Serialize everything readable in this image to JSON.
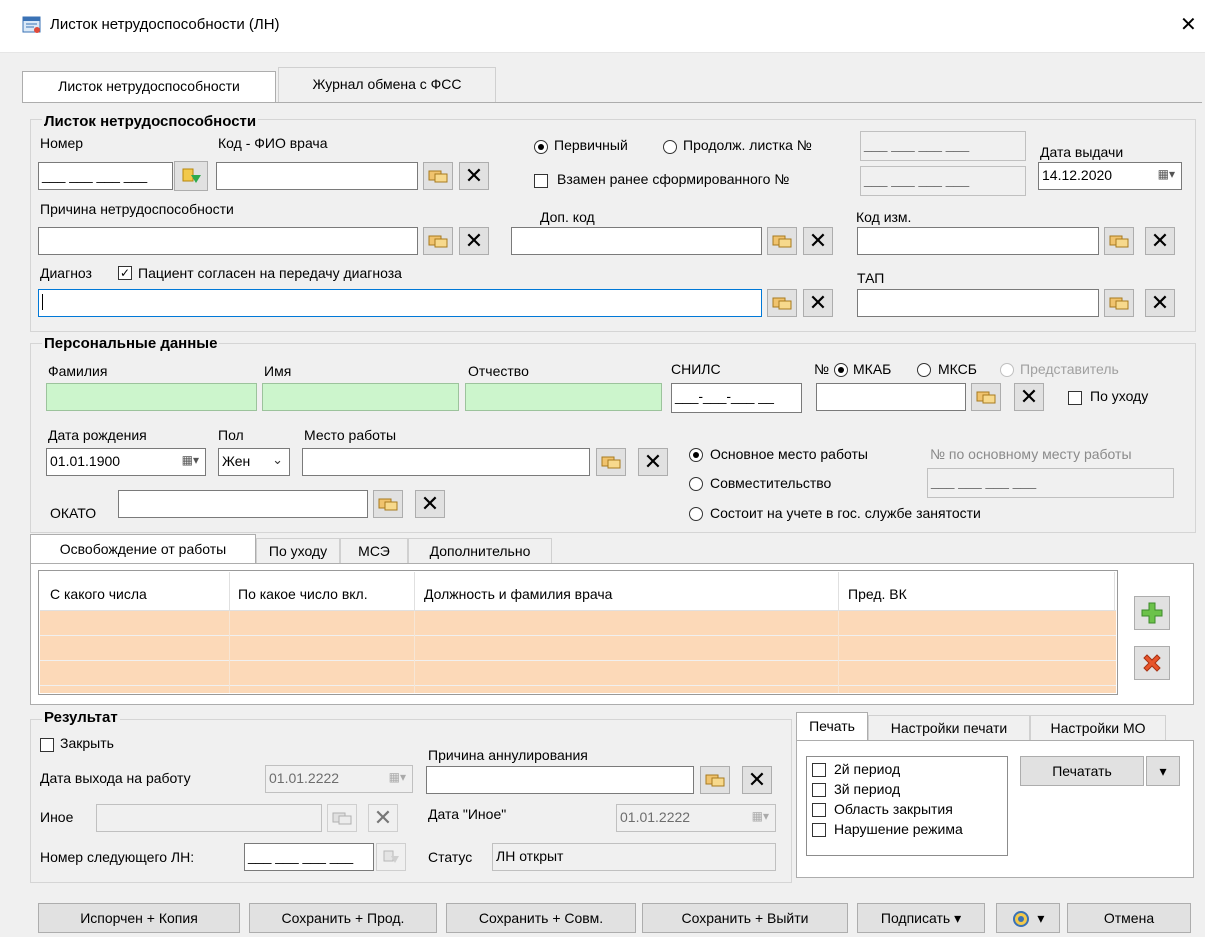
{
  "window": {
    "title": "Листок нетрудоспособности (ЛН)",
    "close": "✕"
  },
  "tabs_top": [
    "Листок нетрудоспособности",
    "Журнал обмена с ФСС"
  ],
  "ln": {
    "group_title": "Листок нетрудоспособности",
    "number_label": "Номер",
    "number_mask": "___ ___ ___ ___",
    "doctor_label": "Код - ФИО врача",
    "primary_label": "Первичный",
    "continuation_label": "Продолж. листка №",
    "continuation_mask": "___ ___ ___ ___",
    "replace_label": "Взамен ранее сформированного №",
    "replace_mask": "___ ___ ___ ___",
    "issue_date_label": "Дата выдачи",
    "issue_date": "14.12.2020",
    "reason_label": "Причина нетрудоспособности",
    "extra_code_label": "Доп. код",
    "change_code_label": "Код изм.",
    "diagnosis_label": "Диагноз",
    "consent_label": "Пациент согласен на передачу диагноза",
    "tap_label": "ТАП"
  },
  "personal": {
    "group_title": "Персональные данные",
    "lastname_label": "Фамилия",
    "firstname_label": "Имя",
    "patronymic_label": "Отчество",
    "snils_label": "СНИЛС",
    "snils_mask": "___-___-___ __",
    "num_label": "№",
    "mkab_label": "МКАБ",
    "mksb_label": "МКСБ",
    "representative_label": "Представитель",
    "care_label": "По уходу",
    "birthdate_label": "Дата рождения",
    "birthdate": "01.01.1900",
    "sex_label": "Пол",
    "sex_value": "Жен",
    "workplace_label": "Место работы",
    "main_work_label": "Основное место работы",
    "main_work_num_label": "№ по основному месту работы",
    "main_work_mask": "___ ___ ___ ___",
    "part_time_label": "Совместительство",
    "employment_label": "Состоит на учете в гос. службе занятости",
    "okato_label": "ОКАТО"
  },
  "release": {
    "tabs": [
      "Освобождение от работы",
      "По уходу",
      "МСЭ",
      "Дополнительно"
    ],
    "columns": [
      "С какого числа",
      "По какое число вкл.",
      "Должность и фамилия врача",
      "Пред. ВК"
    ]
  },
  "result": {
    "group_title": "Результат",
    "close_label": "Закрыть",
    "return_date_label": "Дата выхода на работу",
    "return_date": "01.01.2222",
    "other_label": "Иное",
    "next_ln_label": "Номер следующего ЛН:",
    "next_ln_mask": "___ ___ ___ ___",
    "cancel_reason_label": "Причина аннулирования",
    "other_date_label": "Дата \"Иное\"",
    "other_date": "01.01.2222",
    "status_label": "Статус",
    "status_value": "ЛН открыт"
  },
  "print": {
    "tabs": [
      "Печать",
      "Настройки печати",
      "Настройки МО"
    ],
    "options": [
      "2й период",
      "3й период",
      "Область закрытия",
      "Нарушение режима"
    ],
    "print_button": "Печатать"
  },
  "footer": {
    "spoiled_copy": "Испорчен + Копия",
    "save_continue": "Сохранить + Прод.",
    "save_combined": "Сохранить + Совм.",
    "save_exit": "Сохранить + Выйти",
    "sign": "Подписать",
    "cancel": "Отмена"
  }
}
